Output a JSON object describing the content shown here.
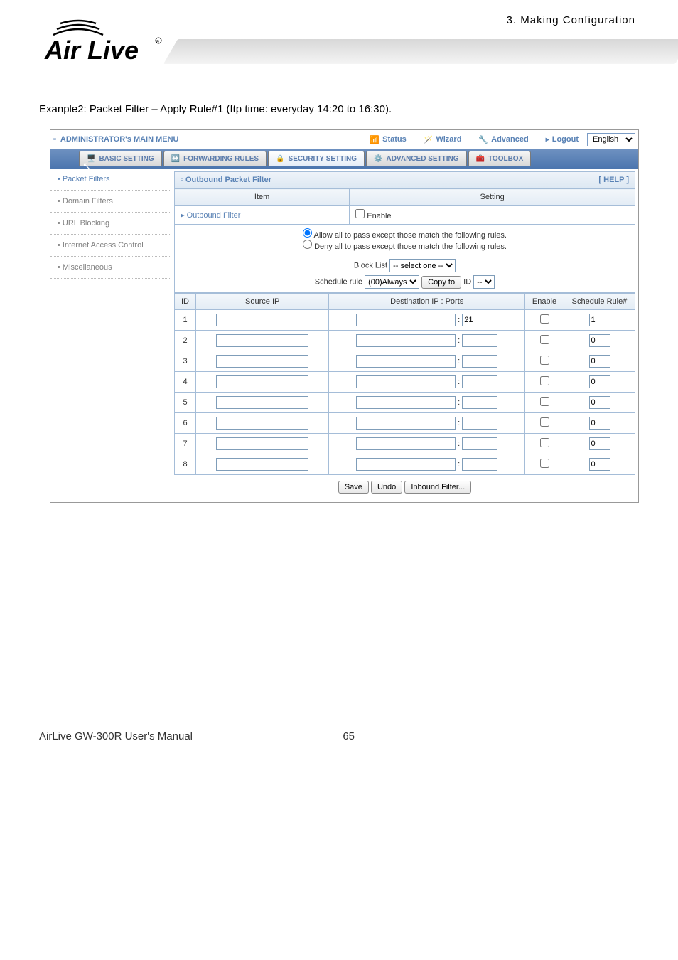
{
  "header": {
    "breadcrumb": "3.  Making  Configuration",
    "example_text": "Exanple2: Packet Filter – Apply Rule#1 (ftp time: everyday 14:20 to 16:30)."
  },
  "topbar": {
    "admin_menu": "ADMINISTRATOR's MAIN MENU",
    "status": "Status",
    "wizard": "Wizard",
    "advanced": "Advanced",
    "logout": "Logout",
    "lang": "English"
  },
  "navtabs": {
    "basic": "BASIC SETTING",
    "forwarding": "FORWARDING RULES",
    "security": "SECURITY SETTING",
    "advanced": "ADVANCED SETTING",
    "toolbox": "TOOLBOX"
  },
  "sidebar": {
    "packet_filters": "Packet Filters",
    "domain_filters": "Domain Filters",
    "url_blocking": "URL Blocking",
    "internet_access": "Internet Access Control",
    "misc": "Miscellaneous"
  },
  "panel": {
    "title": "Outbound Packet Filter",
    "help": "[ HELP ]",
    "item_hdr": "Item",
    "setting_hdr": "Setting",
    "outbound_filter": "Outbound Filter",
    "enable": "Enable",
    "allow_rule": "Allow all to pass except those match the following rules.",
    "deny_rule": "Deny all to pass except those match the following rules.",
    "block_list_lbl": "Block List",
    "block_list_sel": "-- select one --",
    "schedule_rule_lbl": "Schedule rule",
    "schedule_sel": "(00)Always",
    "copy_to": "Copy to",
    "id_lbl": "ID",
    "dash": "--",
    "col_id": "ID",
    "col_src": "Source IP",
    "col_dest": "Destination IP : Ports",
    "col_enable": "Enable",
    "col_rule": "Schedule Rule#",
    "rows": [
      {
        "id": "1",
        "port": "21",
        "rule": "1"
      },
      {
        "id": "2",
        "port": "",
        "rule": "0"
      },
      {
        "id": "3",
        "port": "",
        "rule": "0"
      },
      {
        "id": "4",
        "port": "",
        "rule": "0"
      },
      {
        "id": "5",
        "port": "",
        "rule": "0"
      },
      {
        "id": "6",
        "port": "",
        "rule": "0"
      },
      {
        "id": "7",
        "port": "",
        "rule": "0"
      },
      {
        "id": "8",
        "port": "",
        "rule": "0"
      }
    ],
    "btn_save": "Save",
    "btn_undo": "Undo",
    "btn_inbound": "Inbound Filter..."
  },
  "footer": {
    "left": "AirLive GW-300R User's Manual",
    "page": "65"
  }
}
